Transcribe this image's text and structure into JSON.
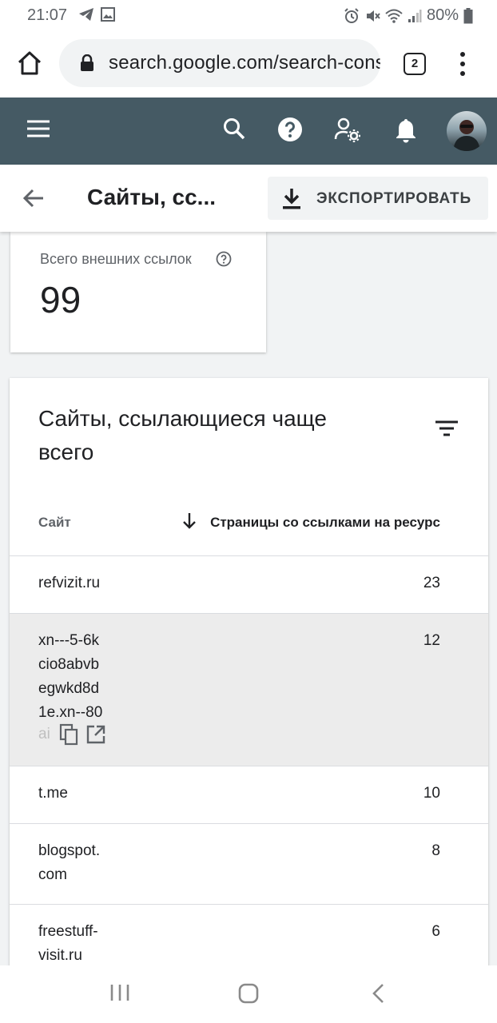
{
  "status_bar": {
    "time": "21:07",
    "battery": "80%",
    "icons": [
      "telegram-icon",
      "image-icon",
      "alarm-icon",
      "mute-icon",
      "wifi-icon",
      "signal-icon",
      "battery-icon"
    ]
  },
  "browser": {
    "url": "search.google.com/search-console",
    "tab_count": "2"
  },
  "app_header": {
    "icons": [
      "menu-icon",
      "search-icon",
      "help-icon",
      "manage-users-icon",
      "notifications-icon",
      "avatar"
    ]
  },
  "page_header": {
    "title": "Сайты, сс...",
    "export_label": "ЭКСПОРТИРОВАТЬ"
  },
  "summary": {
    "label": "Всего внешних ссылок",
    "value": "99"
  },
  "table": {
    "title": "Сайты, ссылающиеся чаще всего",
    "col_site": "Сайт",
    "col_pages": "Страницы со ссылками на ресурс",
    "rows": [
      {
        "site": "refvizit.ru",
        "count": "23"
      },
      {
        "site": "xn---5-6k cio8abvb egwkd8d 1e.xn--80",
        "count": "12",
        "faded": "ai"
      },
      {
        "site": "t.me",
        "count": "10"
      },
      {
        "site": "blogspot. com",
        "count": "8"
      },
      {
        "site": "freestuff- visit.ru",
        "count": "6"
      }
    ]
  },
  "colors": {
    "app_header_bg": "#455a64",
    "highlight_row": "#ececec"
  }
}
